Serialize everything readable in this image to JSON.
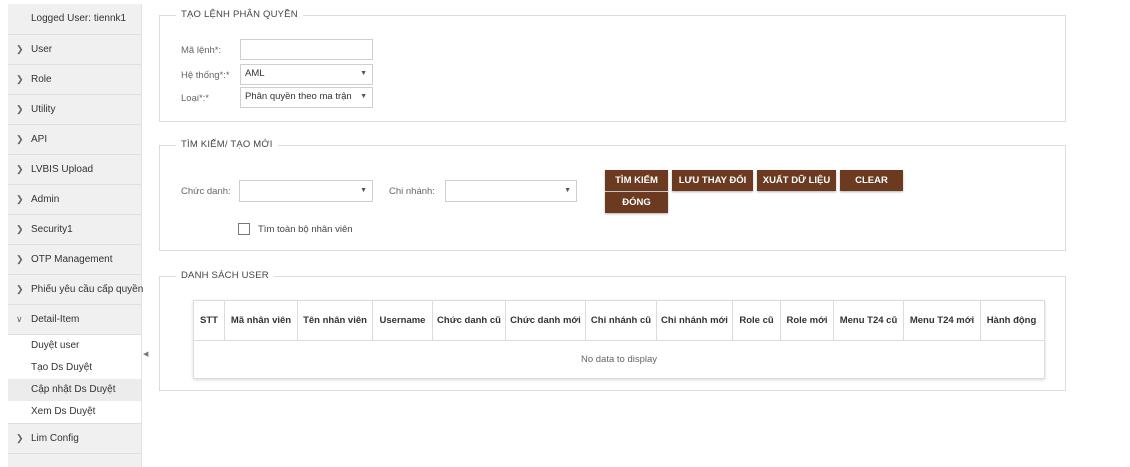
{
  "sidebar": {
    "logged_user": "Logged User: tiennk1",
    "items_before": [
      {
        "label": "User"
      },
      {
        "label": "Role"
      },
      {
        "label": "Utility"
      },
      {
        "label": "API"
      },
      {
        "label": "LVBIS Upload"
      },
      {
        "label": "Admin"
      },
      {
        "label": "Security1"
      },
      {
        "label": "OTP Management"
      },
      {
        "label": "Phiếu yêu cầu cấp quyền"
      }
    ],
    "expanded": {
      "label": "Detail-Item",
      "subitems": [
        {
          "label": "Duyệt user"
        },
        {
          "label": "Tạo Ds Duyệt"
        },
        {
          "label": "Cập nhật Ds Duyệt"
        },
        {
          "label": "Xem Ds Duyệt"
        }
      ],
      "active_subitem": "Cập nhật Ds Duyệt"
    },
    "items_after": [
      {
        "label": "Lim Config"
      }
    ]
  },
  "create_panel": {
    "legend": "TẠO LỆNH PHÂN QUYỀN",
    "code_label": "Mã lệnh*:",
    "code_value": "",
    "system_label": "Hệ thống*:*",
    "system_value": "AML",
    "type_label": "Loại*:*",
    "type_value": "Phân quyền theo ma trận"
  },
  "search_panel": {
    "legend": "TÌM KIẾM/ TẠO MỚI",
    "title_label": "Chức danh:",
    "title_value": "",
    "branch_label": "Chi nhánh:",
    "branch_value": "",
    "buttons": {
      "search": "TÌM KIẾM",
      "save": "LƯU THAY ĐỔI",
      "export": "XUẤT DỮ LIỆU",
      "clear": "CLEAR",
      "close": "ĐÓNG"
    },
    "all_staff_label": "Tìm toàn bộ nhân viên",
    "all_staff_checked": false
  },
  "user_list": {
    "legend": "DANH SÁCH USER",
    "columns": [
      "STT",
      "Mã nhân viên",
      "Tên nhân viên",
      "Username",
      "Chức danh cũ",
      "Chức danh mới",
      "Chi nhánh cũ",
      "Chi nhánh mới",
      "Role cũ",
      "Role mới",
      "Menu T24 cũ",
      "Menu T24 mới",
      "Hành động"
    ],
    "empty_text": "No data to display"
  },
  "icons": {
    "menu_chevron": "chevron-right-icon",
    "expanded_chevron": "chevron-down-icon",
    "select_arrow": "caret-down-icon",
    "collapse_sidebar": "caret-left-icon"
  },
  "colors": {
    "button_bg": "#6b3a21",
    "sidebar_bg": "#f0f0f0"
  }
}
